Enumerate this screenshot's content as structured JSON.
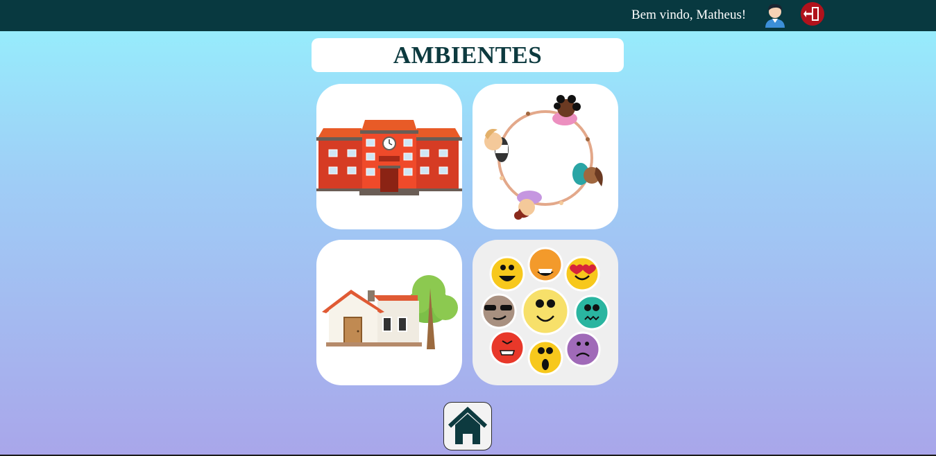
{
  "header": {
    "welcome_text": "Bem vindo, Matheus!",
    "avatar_icon": "user-avatar-icon",
    "logout_icon": "logout-door-icon"
  },
  "main": {
    "title": "AMBIENTES",
    "cards": [
      {
        "icon": "school-building-icon"
      },
      {
        "icon": "children-circle-icon"
      },
      {
        "icon": "house-icon"
      },
      {
        "icon": "emotions-icon"
      }
    ]
  },
  "footer": {
    "home_icon": "home-icon"
  },
  "colors": {
    "header_bg": "#083940",
    "title_text": "#0d3a3f",
    "logout_red": "#b0121c"
  }
}
